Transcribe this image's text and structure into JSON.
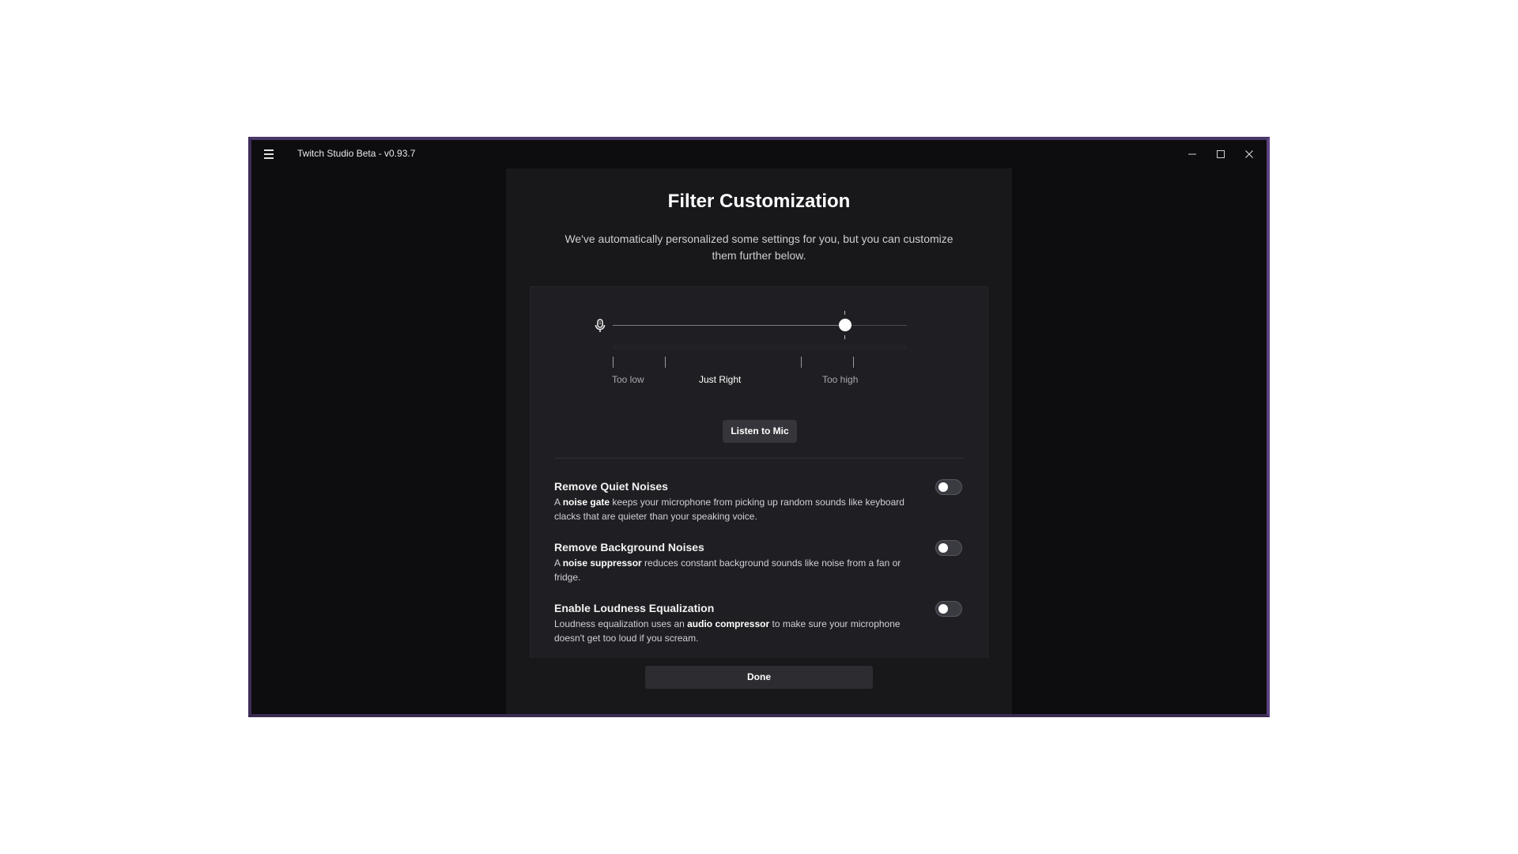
{
  "window": {
    "title": "Twitch Studio Beta - v0.93.7"
  },
  "dialog": {
    "heading": "Filter Customization",
    "subtitle": "We've automatically personalized some settings for you, but you can customize them further below."
  },
  "mic_level": {
    "slider_value_fraction": 0.79,
    "scale_labels": {
      "low": "Too low",
      "mid": "Just Right",
      "high": "Too high"
    }
  },
  "listen_button": {
    "label": "Listen to Mic"
  },
  "options": [
    {
      "title": "Remove Quiet Noises",
      "desc_prefix": "A ",
      "desc_bold": "noise gate",
      "desc_suffix": " keeps your microphone from picking up random sounds like keyboard clacks that are quieter than your speaking voice.",
      "enabled": false
    },
    {
      "title": "Remove Background Noises",
      "desc_prefix": "A ",
      "desc_bold": "noise suppressor",
      "desc_suffix": " reduces constant background sounds like noise from a fan or fridge.",
      "enabled": false
    },
    {
      "title": "Enable Loudness Equalization",
      "desc_prefix": "Loudness equalization uses an ",
      "desc_bold": "audio compressor",
      "desc_suffix": " to make sure your microphone doesn't get too loud if you scream.",
      "enabled": false
    }
  ],
  "done_button": {
    "label": "Done"
  },
  "icons": {
    "menu": "hamburger-menu-icon",
    "minimize": "minimize-icon",
    "maximize": "maximize-icon",
    "close": "close-icon",
    "mic": "microphone-icon"
  }
}
